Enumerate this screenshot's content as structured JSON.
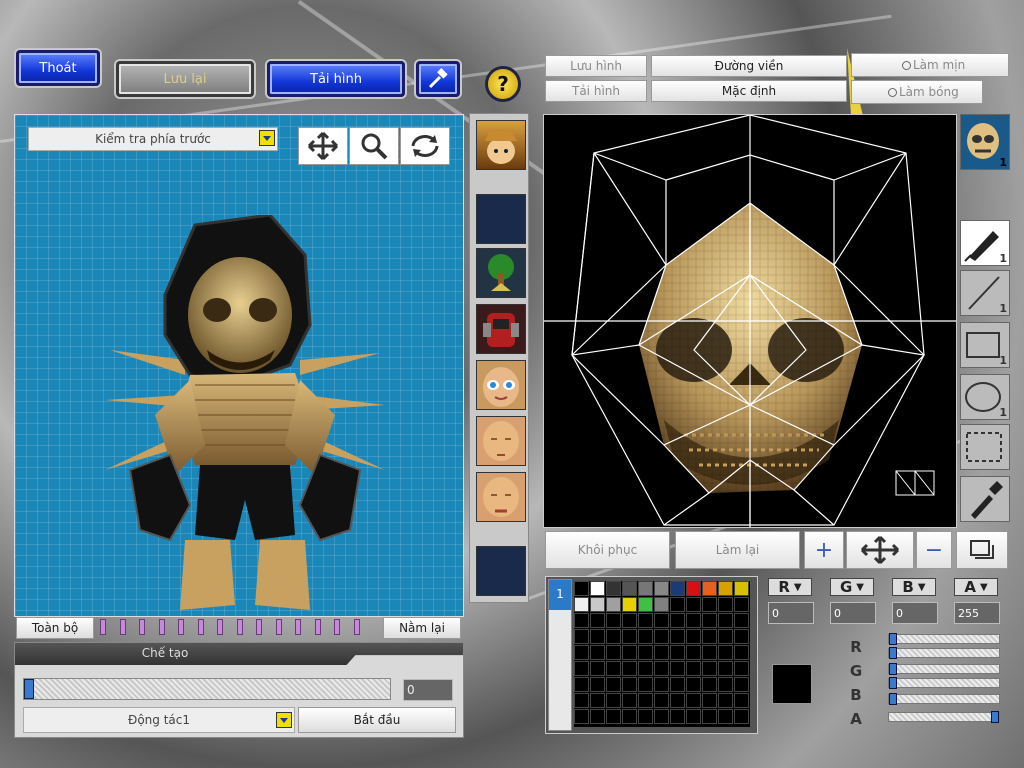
{
  "top_left": {
    "exit_label": "Thoát",
    "save_label": "Lưu lại",
    "load_label": "Tải hình"
  },
  "left_panel": {
    "view_dropdown": "Kiểm tra phía trước",
    "all_button": "Toàn bộ",
    "pause_button": "Nằm lại"
  },
  "bottom_left": {
    "section_title": "Chế tạo",
    "progress_value": "0",
    "motion_dropdown": "Động tác1",
    "start_button": "Bắt đầu",
    "progress_fraction": 0
  },
  "right_top": {
    "save_image": "Lưu hình",
    "load_image": "Tải hình",
    "outline": "Đường viền",
    "default": "Mặc định",
    "smooth": "Làm mịn",
    "shading": "Làm bóng"
  },
  "canvas_tools": {
    "restore": "Khôi phục",
    "redo": "Làm lại"
  },
  "tool_badges": {
    "face": "1",
    "pen": "1",
    "line": "1",
    "rect": "1",
    "ellipse": "1"
  },
  "color": {
    "r_label": "R",
    "g_label": "G",
    "b_label": "B",
    "a_label": "A",
    "r": "0",
    "g": "0",
    "b": "0",
    "a": "255",
    "r_fraction": 0,
    "g_fraction": 0,
    "b_fraction": 0,
    "a_fraction": 1,
    "current_color": "#000000"
  },
  "palette_colors": [
    "#000000",
    "#ffffff",
    "#333333",
    "#555555",
    "#777777",
    "#888888",
    "#1a3a7a",
    "#d81010",
    "#e86020",
    "#d8a000",
    "#d8c000",
    "#f0f0f0",
    "#c8c8c8",
    "#a0a0a0",
    "#e8d000",
    "#40c040",
    "#808080"
  ],
  "palette_tab": "1"
}
